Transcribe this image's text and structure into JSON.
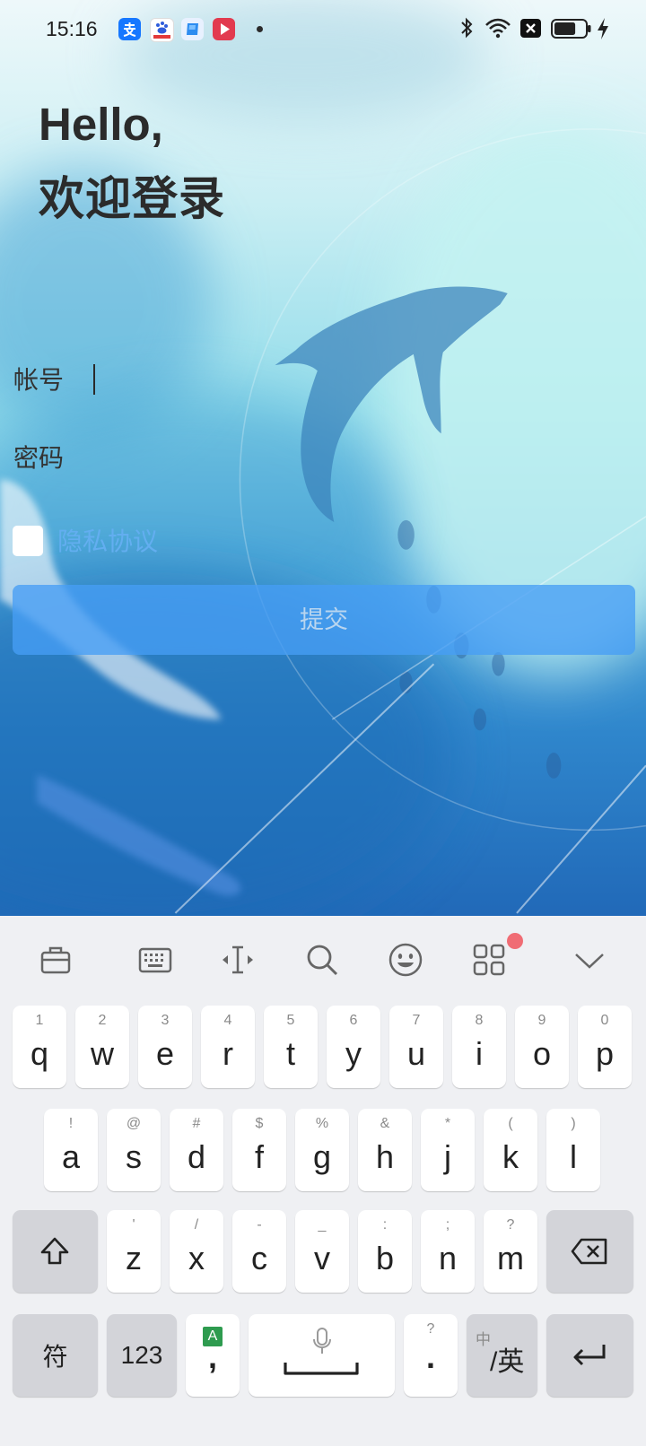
{
  "status_bar": {
    "time": "15:16",
    "notification_icons": [
      "alipay-icon",
      "baidu-icon",
      "blue-app-icon",
      "video-app-icon",
      "more-notifications-dot"
    ],
    "system_icons": [
      "bluetooth-icon",
      "wifi-icon",
      "no-sim-icon",
      "battery-icon",
      "charging-icon"
    ],
    "battery_level": 0.7
  },
  "greeting": {
    "line1": "Hello,",
    "line2": "欢迎登录"
  },
  "form": {
    "account": {
      "label": "帐号",
      "value": ""
    },
    "password": {
      "label": "密码",
      "value": ""
    },
    "privacy": {
      "checked": false,
      "label": "隐私协议"
    },
    "submit_label": "提交"
  },
  "keyboard": {
    "toolbar": [
      "briefcase-icon",
      "keyboard-icon",
      "text-cursor-icon",
      "search-icon",
      "emoji-icon",
      "apps-grid-icon",
      "chevron-down-icon"
    ],
    "toolbar_badge": true,
    "row1": [
      {
        "main": "q",
        "sub": "1"
      },
      {
        "main": "w",
        "sub": "2"
      },
      {
        "main": "e",
        "sub": "3"
      },
      {
        "main": "r",
        "sub": "4"
      },
      {
        "main": "t",
        "sub": "5"
      },
      {
        "main": "y",
        "sub": "6"
      },
      {
        "main": "u",
        "sub": "7"
      },
      {
        "main": "i",
        "sub": "8"
      },
      {
        "main": "o",
        "sub": "9"
      },
      {
        "main": "p",
        "sub": "0"
      }
    ],
    "row2": [
      {
        "main": "a",
        "sub": "!"
      },
      {
        "main": "s",
        "sub": "@"
      },
      {
        "main": "d",
        "sub": "#"
      },
      {
        "main": "f",
        "sub": "$"
      },
      {
        "main": "g",
        "sub": "%"
      },
      {
        "main": "h",
        "sub": "&"
      },
      {
        "main": "j",
        "sub": "*"
      },
      {
        "main": "k",
        "sub": "("
      },
      {
        "main": "l",
        "sub": ")"
      }
    ],
    "row3": [
      {
        "main": "z",
        "sub": "'"
      },
      {
        "main": "x",
        "sub": "/"
      },
      {
        "main": "c",
        "sub": "-"
      },
      {
        "main": "v",
        "sub": "_"
      },
      {
        "main": "b",
        "sub": ":"
      },
      {
        "main": "n",
        "sub": ";"
      },
      {
        "main": "m",
        "sub": "?"
      }
    ],
    "row4": {
      "symbols": "符",
      "numbers": "123",
      "comma": {
        "badge": "A",
        "main": ","
      },
      "space_icon": "microphone-icon",
      "period": {
        "sub": "?",
        "main": "."
      },
      "language": {
        "sub": "中",
        "main": "/英"
      },
      "enter_icon": "enter-icon"
    },
    "shift_icon": "shift-icon",
    "backspace_icon": "backspace-icon"
  },
  "colors": {
    "submit_button": "#469ef5",
    "privacy_link": "#63aef0",
    "badge": "#f06c74",
    "key_gray": "#d3d4d9",
    "keyboard_bg": "#eff0f3"
  }
}
